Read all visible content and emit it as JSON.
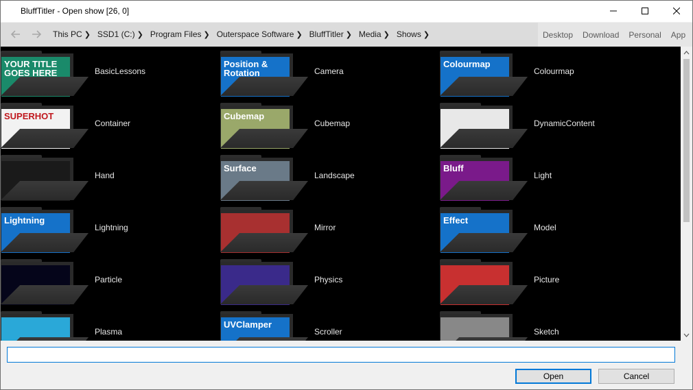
{
  "window": {
    "title": "BluffTitler - Open show [26, 0]"
  },
  "nav": {
    "breadcrumb": [
      "This PC",
      "SSD1 (C:)",
      "Program Files",
      "Outerspace Software",
      "BluffTitler",
      "Media",
      "Shows"
    ],
    "quick_links": [
      "Desktop",
      "Download",
      "Personal",
      "App"
    ]
  },
  "items": [
    {
      "label": "BasicLessons",
      "thumb_text": "YOUR TITLE GOES HERE",
      "thumb_color": "#1a8a6a"
    },
    {
      "label": "Camera",
      "thumb_text": "Position & Rotation",
      "thumb_color": "#1572c9"
    },
    {
      "label": "Colourmap",
      "thumb_text": "Colourmap",
      "thumb_color": "#1572c9"
    },
    {
      "label": "Container",
      "thumb_text": "SUPERHOT",
      "thumb_color": "#f2f2f2"
    },
    {
      "label": "Cubemap",
      "thumb_text": "Cubemap",
      "thumb_color": "#9aa86a"
    },
    {
      "label": "DynamicContent",
      "thumb_text": "",
      "thumb_color": "#e8e8e8"
    },
    {
      "label": "Hand",
      "thumb_text": "",
      "thumb_color": "#1a1a1a"
    },
    {
      "label": "Landscape",
      "thumb_text": "Surface",
      "thumb_color": "#6a7a88"
    },
    {
      "label": "Light",
      "thumb_text": "Bluff",
      "thumb_color": "#7a1a8a"
    },
    {
      "label": "Lightning",
      "thumb_text": "Lightning",
      "thumb_color": "#1572c9"
    },
    {
      "label": "Mirror",
      "thumb_text": "",
      "thumb_color": "#a83030"
    },
    {
      "label": "Model",
      "thumb_text": "Effect",
      "thumb_color": "#1572c9"
    },
    {
      "label": "Particle",
      "thumb_text": "",
      "thumb_color": "#05051a"
    },
    {
      "label": "Physics",
      "thumb_text": "",
      "thumb_color": "#3a2a8a"
    },
    {
      "label": "Picture",
      "thumb_text": "",
      "thumb_color": "#c83030"
    },
    {
      "label": "Plasma",
      "thumb_text": "",
      "thumb_color": "#2aa8d8"
    },
    {
      "label": "Scroller",
      "thumb_text": "UVClamper",
      "thumb_color": "#1572c9"
    },
    {
      "label": "Sketch",
      "thumb_text": "",
      "thumb_color": "#888888"
    }
  ],
  "input": {
    "value": ""
  },
  "buttons": {
    "open": "Open",
    "cancel": "Cancel"
  }
}
